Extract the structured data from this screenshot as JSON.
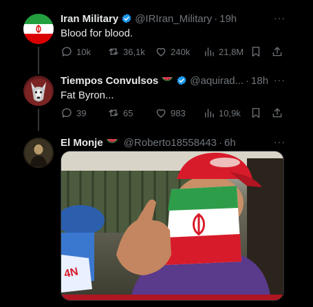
{
  "tweets": [
    {
      "name": "Iran Military",
      "handle": "@IRIran_Military",
      "time": "19h",
      "text": "Blood for blood.",
      "replies": "10k",
      "retweets": "36,1k",
      "likes": "240k",
      "views": "21,8M",
      "avatar_icon": "iran-flag-avatar",
      "verified": true
    },
    {
      "name": "Tiempos Convulsos",
      "handle": "@aquirad...",
      "time": "18h",
      "text": "Fat Byron...",
      "replies": "39",
      "retweets": "65",
      "likes": "983",
      "views": "10,9k",
      "avatar_icon": "wolf-avatar",
      "emoji": "watermelon",
      "verified": true
    },
    {
      "name": "El Monje",
      "handle": "@Roberto18558443",
      "time": "6h",
      "avatar_icon": "portrait-avatar",
      "emoji": "watermelon",
      "media": "photo-man-red-cap-iran-flag-mask"
    }
  ],
  "separator": "·",
  "more_glyph": "···",
  "media_overlay": {
    "microphone_label": "4N"
  },
  "colors": {
    "background": "#000000",
    "text": "#e7e9ea",
    "muted": "#71767b",
    "verified": "#1d9bf0",
    "thread_line": "#333639"
  }
}
